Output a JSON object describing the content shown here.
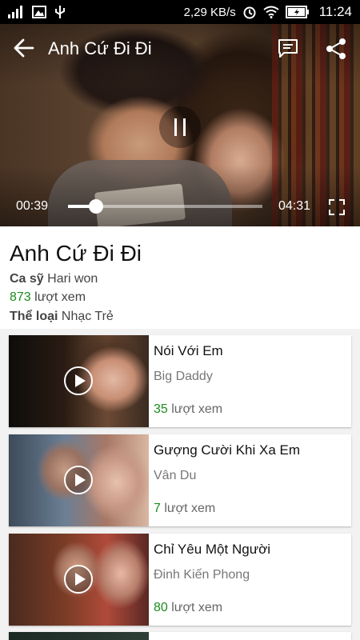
{
  "status_bar": {
    "net_speed": "2,29 KB/s",
    "time": "11:24"
  },
  "player": {
    "title": "Anh Cứ Đi Đi",
    "current_time": "00:39",
    "total_time": "04:31",
    "progress": 0.144
  },
  "info": {
    "title": "Anh Cứ Đi Đi",
    "singer_label": "Ca sỹ",
    "singer": "Hari won",
    "views_count": "873",
    "views_label": "lượt xem",
    "genre_label": "Thể loại",
    "genre": "Nhạc Trẻ"
  },
  "related": [
    {
      "title": "Nói Với Em",
      "artist": "Big Daddy",
      "views": "35",
      "views_label": "lượt xem"
    },
    {
      "title": "Gượng Cười Khi Xa Em",
      "artist": "Vân Du",
      "views": "7",
      "views_label": "lượt xem"
    },
    {
      "title": "Chỉ Yêu Một Người",
      "artist": "Đinh Kiến Phong",
      "views": "80",
      "views_label": "lượt xem"
    }
  ],
  "colors": {
    "accent_green": "#1a8c1a",
    "statusbar": "#000000"
  },
  "icons": [
    "signal-icon",
    "image-icon",
    "usb-icon",
    "alarm-icon",
    "wifi-icon",
    "battery-icon",
    "back-arrow-icon",
    "comment-icon",
    "share-icon",
    "pause-icon",
    "fullscreen-icon",
    "play-icon"
  ]
}
